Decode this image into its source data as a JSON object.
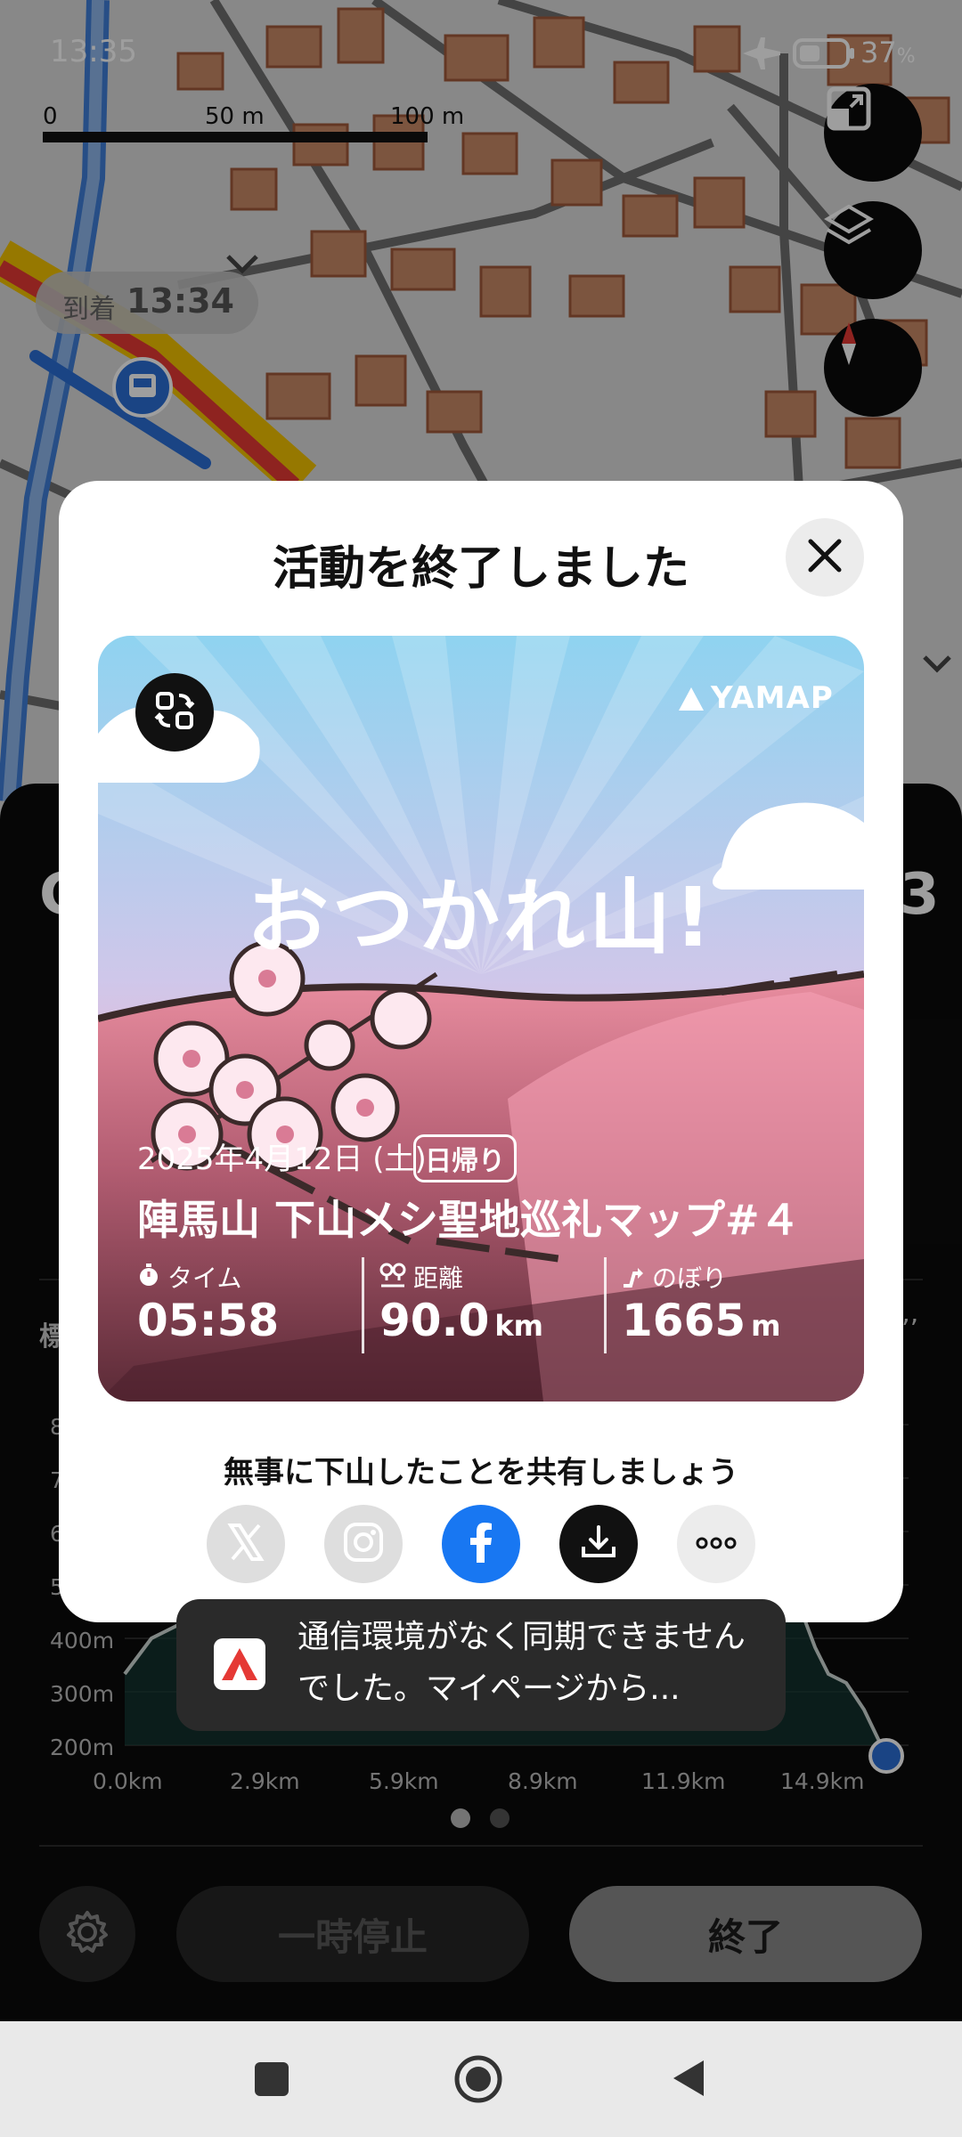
{
  "status_bar": {
    "time": "13:35",
    "battery": "37",
    "battery_unit": "%"
  },
  "map": {
    "scale_labels": [
      "0",
      "50 m",
      "100 m"
    ],
    "arrival_label": "到着",
    "arrival_time": "13:34"
  },
  "map_controls": [
    "fit-route-icon",
    "layers-icon",
    "compass-icon"
  ],
  "panel": {
    "left_partial_text": "C",
    "right_partial_text": "3",
    "section_partial_label": "標",
    "section_partial_right": "’’",
    "elevation_ticks": [
      "8",
      "7",
      "6",
      "5",
      "400m",
      "300m",
      "200m"
    ],
    "distance_ticks": [
      "0.0km",
      "2.9km",
      "5.9km",
      "8.9km",
      "11.9km",
      "14.9km"
    ],
    "page_dots": 2,
    "pause_label": "一時停止",
    "end_label": "終了"
  },
  "modal": {
    "title": "活動を終了しました",
    "card": {
      "brand": "YAMAP",
      "cheer": "おつかれ山!",
      "date": "2025年4月12日 (土)",
      "day_badge": "日帰り",
      "activity_name": "陣馬山 下山メシ聖地巡礼マップ#４",
      "stats": [
        {
          "label": "タイム",
          "value": "05:58",
          "unit": ""
        },
        {
          "label": "距離",
          "value": "90.0",
          "unit": "km"
        },
        {
          "label": "のぼり",
          "value": "1665",
          "unit": "m"
        }
      ]
    },
    "share_prompt": "無事に下山したことを共有しましょう",
    "share_buttons": [
      "x-icon",
      "instagram-icon",
      "facebook-icon",
      "download-icon",
      "more-icon"
    ]
  },
  "toast": {
    "text": "通信環境がなく同期できませんでした。マイページから..."
  },
  "colors": {
    "facebook": "#1877f2",
    "route_red": "#e53935",
    "route_yellow": "#f2c200",
    "route_blue": "#2a6fd6",
    "card_sky": "#a9ddf3",
    "card_pink": "#e98ea0"
  }
}
